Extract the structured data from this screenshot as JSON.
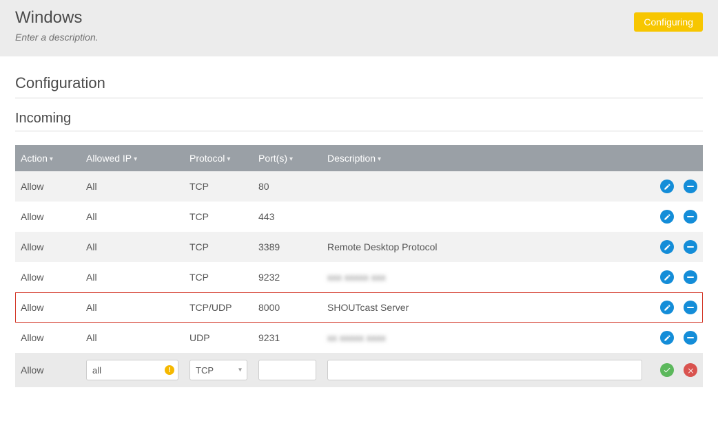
{
  "header": {
    "title": "Windows",
    "subtitle": "Enter a description.",
    "status_badge": "Configuring"
  },
  "section": {
    "title": "Configuration",
    "subtitle": "Incoming"
  },
  "columns": {
    "action": "Action",
    "allowed_ip": "Allowed IP",
    "protocol": "Protocol",
    "ports": "Port(s)",
    "description": "Description"
  },
  "rows": [
    {
      "action": "Allow",
      "ip": "All",
      "protocol": "TCP",
      "ports": "80",
      "description": "",
      "highlight": false,
      "blurred": false
    },
    {
      "action": "Allow",
      "ip": "All",
      "protocol": "TCP",
      "ports": "443",
      "description": "",
      "highlight": false,
      "blurred": false
    },
    {
      "action": "Allow",
      "ip": "All",
      "protocol": "TCP",
      "ports": "3389",
      "description": "Remote Desktop Protocol",
      "highlight": false,
      "blurred": false
    },
    {
      "action": "Allow",
      "ip": "All",
      "protocol": "TCP",
      "ports": "9232",
      "description": "xxx xxxxx xxx",
      "highlight": false,
      "blurred": true
    },
    {
      "action": "Allow",
      "ip": "All",
      "protocol": "TCP/UDP",
      "ports": "8000",
      "description": "SHOUTcast Server",
      "highlight": true,
      "blurred": false
    },
    {
      "action": "Allow",
      "ip": "All",
      "protocol": "UDP",
      "ports": "9231",
      "description": "xx xxxxx xxxx",
      "highlight": false,
      "blurred": true
    }
  ],
  "form_row": {
    "action": "Allow",
    "ip_value": "all",
    "protocol_value": "TCP",
    "ports_value": "",
    "description_value": ""
  }
}
